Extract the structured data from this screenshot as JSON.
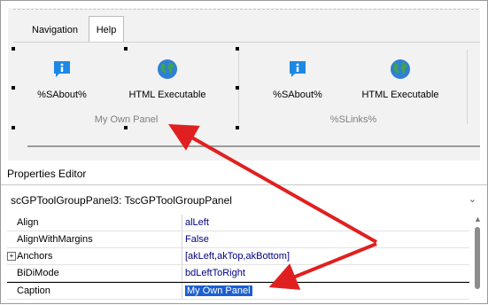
{
  "ribbon": {
    "tabs": [
      {
        "label": "Navigation"
      },
      {
        "label": "Help"
      }
    ],
    "panels": [
      {
        "caption": "My Own Panel",
        "buttons": [
          {
            "label": "%SAbout%",
            "icon": "info-icon"
          },
          {
            "label": "HTML Executable",
            "icon": "globe-icon"
          }
        ]
      },
      {
        "caption": "%SLinks%",
        "buttons": [
          {
            "label": "%SAbout%",
            "icon": "info-icon"
          },
          {
            "label": "HTML Executable",
            "icon": "globe-icon"
          }
        ]
      }
    ]
  },
  "properties": {
    "title": "Properties Editor",
    "component": "scGPToolGroupPanel3: TscGPToolGroupPanel",
    "rows": [
      {
        "name": "Align",
        "value": "alLeft"
      },
      {
        "name": "AlignWithMargins",
        "value": "False"
      },
      {
        "name": "Anchors",
        "value": "[akLeft,akTop,akBottom]"
      },
      {
        "name": "BiDiMode",
        "value": "bdLeftToRight"
      },
      {
        "name": "Caption",
        "value": "My Own Panel"
      }
    ]
  },
  "colors": {
    "annotation_arrow": "#e02020",
    "selection": "#1c5fd1",
    "value_text": "#000080",
    "info_icon": "#1e88e5"
  }
}
